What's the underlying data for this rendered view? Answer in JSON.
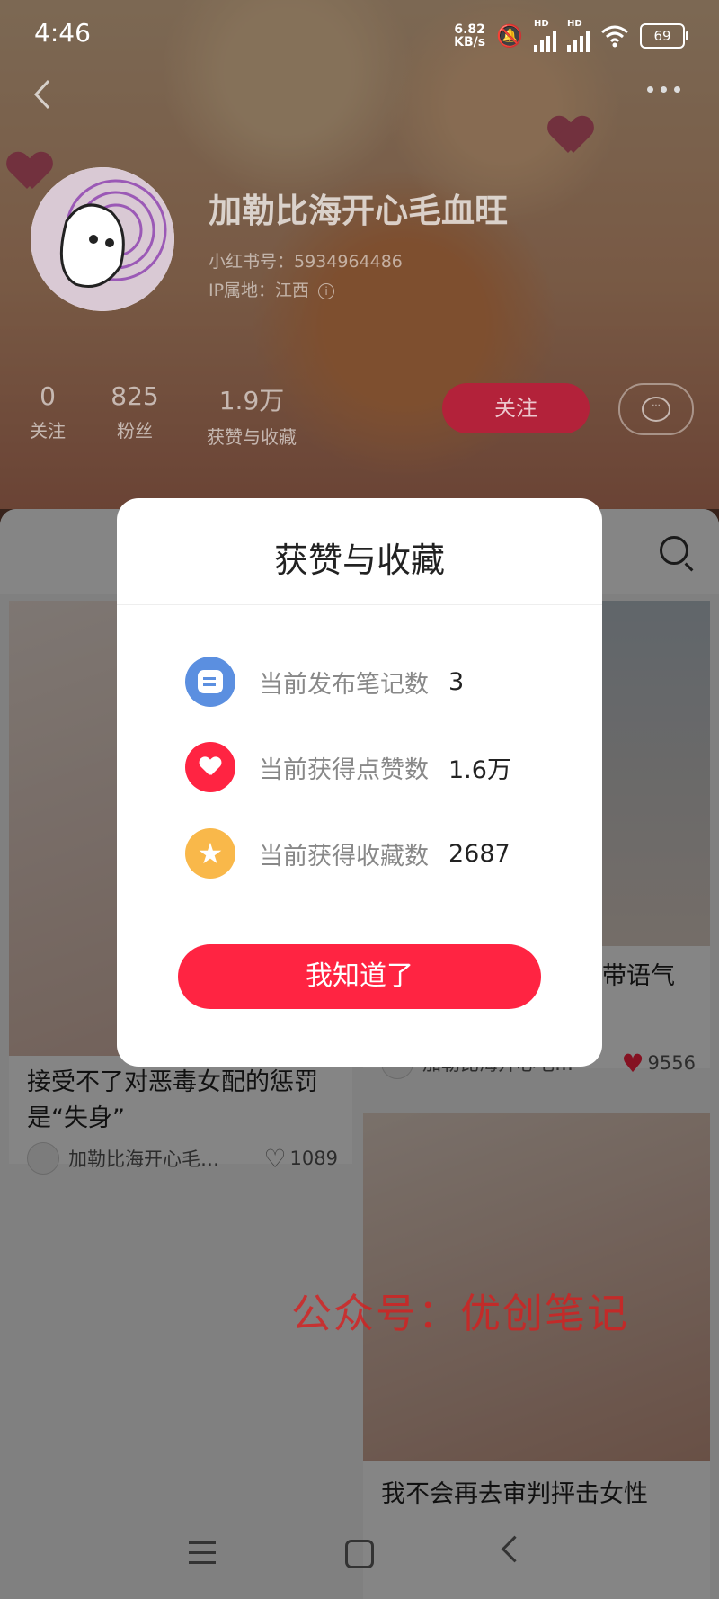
{
  "status_bar": {
    "time": "4:46",
    "net_speed_value": "6.82",
    "net_speed_unit": "KB/s",
    "signal_label_1": "HD",
    "signal_label_2": "HD",
    "battery": "69"
  },
  "profile": {
    "name": "加勒比海开心毛血旺",
    "id": "小红书号：5934964486",
    "ip": "IP属地：江西",
    "stats": [
      {
        "num": "0",
        "label": "关注"
      },
      {
        "num": "825",
        "label": "粉丝"
      },
      {
        "num": "1.9万",
        "label": "获赞与收藏"
      }
    ],
    "follow_label": "关注",
    "message_icon": "chat-bubble-icon"
  },
  "cards": [
    {
      "title": "接受不了对恶毒女配的惩罚是“失身”",
      "author": "加勒比海开心毛…",
      "likes": "1089",
      "liked": false
    },
    {
      "title": "带语气",
      "author": "加勒比海开心毛…",
      "likes": "9556",
      "liked": true
    },
    {
      "title": "我不会再去审判抨击女性",
      "author": "",
      "likes": "",
      "liked": false
    }
  ],
  "watermark": "公众号：优创笔记",
  "modal": {
    "title": "获赞与收藏",
    "rows": [
      {
        "icon": "note-icon",
        "label": "当前发布笔记数",
        "value": "3",
        "color": "#5b8fe0"
      },
      {
        "icon": "heart-icon",
        "label": "当前获得点赞数",
        "value": "1.6万",
        "color": "#ff2442"
      },
      {
        "icon": "star-icon",
        "label": "当前获得收藏数",
        "value": "2687",
        "color": "#f9b84a"
      }
    ],
    "confirm_label": "我知道了"
  },
  "colors": {
    "accent": "#ff2442",
    "follow_button": "#b3223a"
  }
}
